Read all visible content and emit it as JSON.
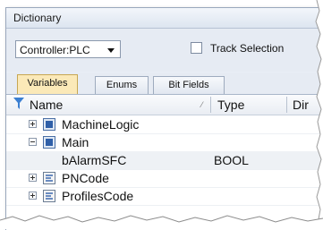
{
  "window": {
    "title": "Dictionary"
  },
  "toolbar": {
    "controller_select": {
      "value": "Controller:PLC"
    },
    "track_selection": {
      "label": "Track Selection",
      "checked": false
    }
  },
  "tabs": [
    {
      "label": "Variables",
      "active": true
    },
    {
      "label": "Enums",
      "active": false
    },
    {
      "label": "Bit Fields",
      "active": false
    }
  ],
  "columns": {
    "name": "Name",
    "type": "Type",
    "dir": "Dir"
  },
  "rows": [
    {
      "name": "MachineLogic",
      "type": "",
      "expander": "plus",
      "icon": "program-icon"
    },
    {
      "name": "Main",
      "type": "",
      "expander": "minus",
      "icon": "program-icon"
    },
    {
      "name": "bAlarmSFC",
      "type": "BOOL",
      "expander": "",
      "icon": ""
    },
    {
      "name": "PNCode",
      "type": "",
      "expander": "plus",
      "icon": "function-block-icon"
    },
    {
      "name": "ProfilesCode",
      "type": "",
      "expander": "plus",
      "icon": "function-block-icon"
    }
  ],
  "colors": {
    "active_tab": "#fbe9b8",
    "panel_bg": "#e9eef6"
  }
}
